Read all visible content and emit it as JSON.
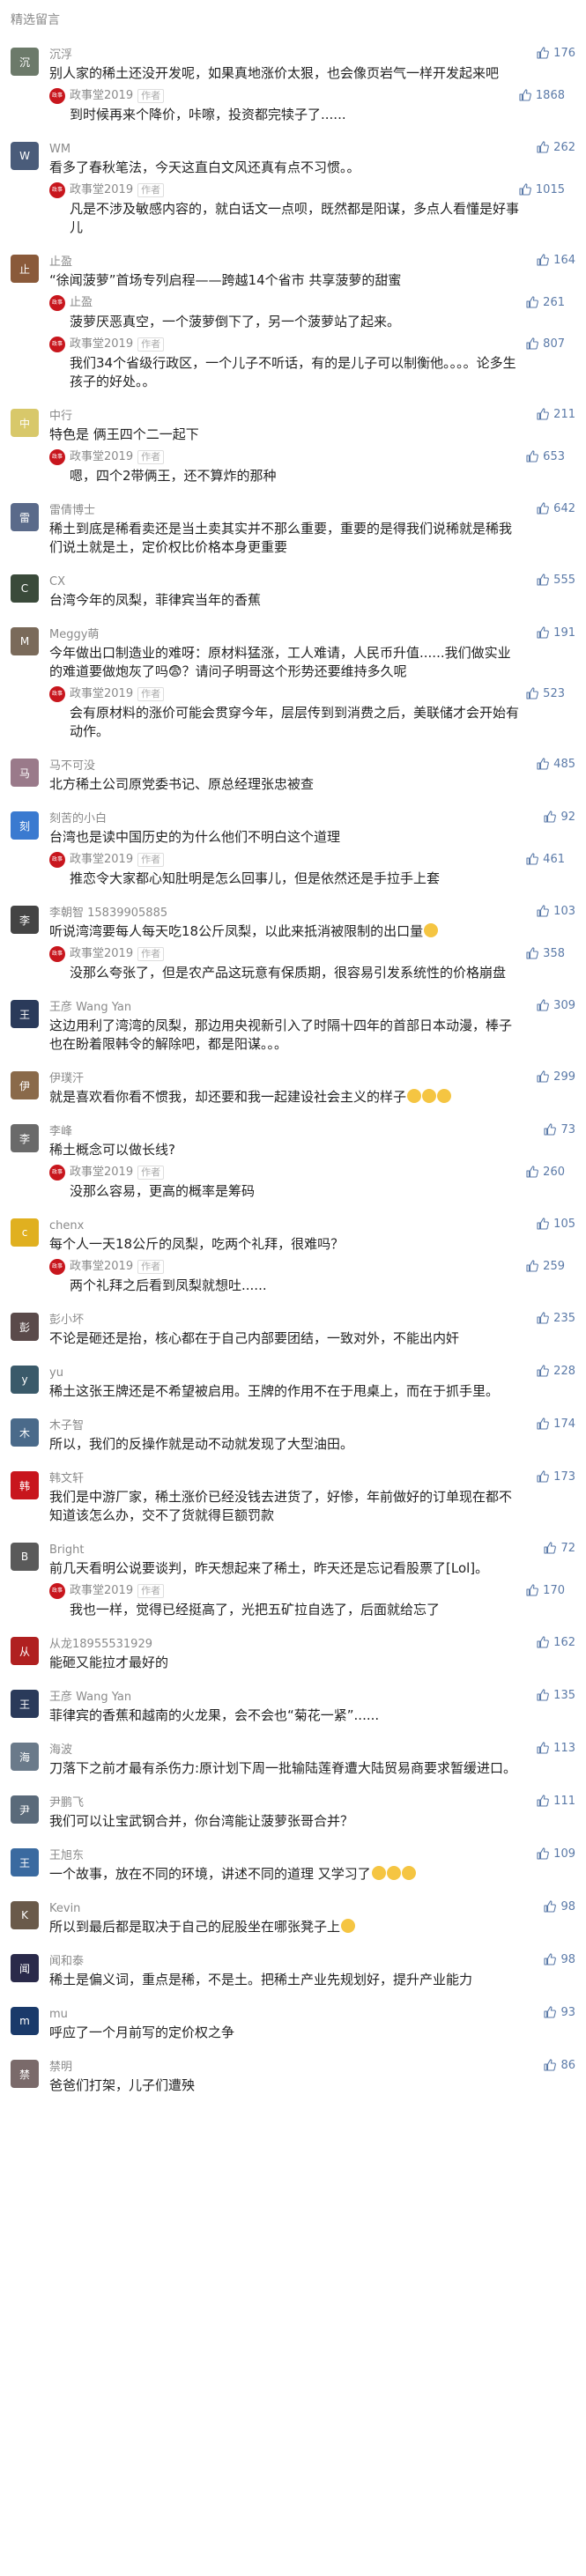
{
  "header": {
    "title": "精选留言"
  },
  "colors": {
    "like": "#5b7aa8",
    "author_avatar": "#c8161d"
  },
  "comments": [
    {
      "nick": "沉浮",
      "likes": "176",
      "text": "别人家的稀土还没开发呢，如果真地涨价太狠，也会像页岩气一样开发起来吧",
      "avatar": "#6c7a6a",
      "reply": {
        "name": "政事堂2019",
        "tag": "作者",
        "likes": "1868",
        "text": "到时候再来个降价，咔嚓，投资都完犊子了......"
      }
    },
    {
      "nick": "WM",
      "likes": "262",
      "text": "看多了春秋笔法，今天这直白文风还真有点不习惯。。",
      "avatar": "#4a5c7a",
      "reply": {
        "name": "政事堂2019",
        "tag": "作者",
        "likes": "1015",
        "text": "凡是不涉及敏感内容的，就白话文一点呗，既然都是阳谋，多点人看懂是好事儿"
      }
    },
    {
      "nick": "止盈",
      "likes": "164",
      "text": "“徐闻菠萝”首场专列启程——跨越14个省市 共享菠萝的甜蜜",
      "avatar": "#8a5a3a",
      "reply": {
        "name": "止盈",
        "tag": "",
        "likes": "261",
        "text": "菠萝厌恶真空，一个菠萝倒下了，另一个菠萝站了起来。"
      },
      "reply2": {
        "name": "政事堂2019",
        "tag": "作者",
        "likes": "807",
        "text": "我们34个省级行政区，一个儿子不听话，有的是儿子可以制衡他。。。。论多生孩子的好处。。"
      }
    },
    {
      "nick": "中行",
      "likes": "211",
      "text": "特色是 俩王四个二一起下",
      "avatar": "#d8c86a",
      "reply": {
        "name": "政事堂2019",
        "tag": "作者",
        "likes": "653",
        "text": "嗯，四个2带俩王，还不算炸的那种"
      }
    },
    {
      "nick": "雷倩博士",
      "likes": "642",
      "text": "稀土到底是稀看卖还是当土卖其实并不那么重要，重要的是得我们说稀就是稀我们说土就是土，定价权比价格本身更重要",
      "avatar": "#5a6a8a"
    },
    {
      "nick": "CX",
      "likes": "555",
      "text": "台湾今年的凤梨，菲律宾当年的香蕉",
      "avatar": "#3a4a3a"
    },
    {
      "nick": "Meggy萌",
      "likes": "191",
      "text": "今年做出口制造业的难呀：原材料猛涨，工人难请，人民币升值......我们做实业的难道要做炮灰了吗😨？请问子明哥这个形势还要维持多久呢",
      "avatar": "#7a6a5a",
      "reply": {
        "name": "政事堂2019",
        "tag": "作者",
        "likes": "523",
        "text": "会有原材料的涨价可能会贯穿今年，层层传到到消费之后，美联储才会开始有动作。"
      }
    },
    {
      "nick": "马不可没",
      "likes": "485",
      "text": "北方稀土公司原党委书记、原总经理张忠被查",
      "avatar": "#9a7a8a"
    },
    {
      "nick": "刻苦的小白",
      "likes": "92",
      "text": "台湾也是读中国历史的为什么他们不明白这个道理",
      "avatar": "#3a7ad0",
      "reply": {
        "name": "政事堂2019",
        "tag": "作者",
        "likes": "461",
        "text": "推恋令大家都心知肚明是怎么回事儿，但是依然还是手拉手上套"
      }
    },
    {
      "nick": "李朝智 15839905885",
      "likes": "103",
      "text": "听说湾湾要每人每天吃18公斤凤梨，以此来抵消被限制的出口量",
      "avatar": "#444444",
      "emoji": true,
      "reply": {
        "name": "政事堂2019",
        "tag": "作者",
        "likes": "358",
        "text": "没那么夸张了，但是农产品这玩意有保质期，很容易引发系统性的价格崩盘"
      }
    },
    {
      "nick": "王彦 Wang Yan",
      "likes": "309",
      "text": "这边用利了湾湾的凤梨，那边用央视新引入了时隔十四年的首部日本动漫，棒子也在盼着限韩令的解除吧，都是阳谋。。。",
      "avatar": "#2a3a5a"
    },
    {
      "nick": "伊璞汗",
      "likes": "299",
      "text": "就是喜欢看你看不惯我，却还要和我一起建设社会主义的样子",
      "avatar": "#8a6a4a",
      "emoji3": true
    },
    {
      "nick": "李峰",
      "likes": "73",
      "text": "稀土概念可以做长线?",
      "avatar": "#6a6a6a",
      "reply": {
        "name": "政事堂2019",
        "tag": "作者",
        "likes": "260",
        "text": "没那么容易，更高的概率是筹码"
      }
    },
    {
      "nick": "chenx",
      "likes": "105",
      "text": "每个人一天18公斤的凤梨，吃两个礼拜，很难吗？",
      "avatar": "#e0b020",
      "reply": {
        "name": "政事堂2019",
        "tag": "作者",
        "likes": "259",
        "text": "两个礼拜之后看到凤梨就想吐......"
      }
    },
    {
      "nick": "彭小坏",
      "likes": "235",
      "text": "不论是砸还是抬，核心都在于自己内部要团结，一致对外，不能出内奸",
      "avatar": "#5a4a4a"
    },
    {
      "nick": "yu",
      "likes": "228",
      "text": "稀土这张王牌还是不希望被启用。王牌的作用不在于甩桌上，而在于抓手里。",
      "avatar": "#3a5a6a"
    },
    {
      "nick": "木子智",
      "likes": "174",
      "text": "所以，我们的反操作就是动不动就发现了大型油田。",
      "avatar": "#4a6a8a"
    },
    {
      "nick": "韩文轩",
      "likes": "173",
      "text": "我们是中游厂家，稀土涨价已经没钱去进货了，好惨，年前做好的订单现在都不知道该怎么办，交不了货就得巨额罚款",
      "avatar": "#c8161d"
    },
    {
      "nick": "Bright",
      "likes": "72",
      "text": "前几天看明公说要谈判，昨天想起来了稀土，昨天还是忘记看股票了[Lol]。",
      "avatar": "#5a5a5a",
      "reply": {
        "name": "政事堂2019",
        "tag": "作者",
        "likes": "170",
        "text": "我也一样，觉得已经挺高了，光把五矿拉自选了，后面就给忘了"
      }
    },
    {
      "nick": "从龙18955531929",
      "likes": "162",
      "text": "能砸又能拉才最好的",
      "avatar": "#b02020"
    },
    {
      "nick": "王彦 Wang Yan",
      "likes": "135",
      "text": "菲律宾的香蕉和越南的火龙果，会不会也“菊花一紧”......",
      "avatar": "#2a3a5a"
    },
    {
      "nick": "海波",
      "likes": "113",
      "text": "刀落下之前才最有杀伤力:原计划下周一批输陆莲脊遭大陆贸易商要求暂缓进口。",
      "avatar": "#6a7a8a"
    },
    {
      "nick": "尹鹏飞",
      "likes": "111",
      "text": "我们可以让宝武钢合并，你台湾能让菠萝张哥合并？",
      "avatar": "#5a6a7a"
    },
    {
      "nick": "王旭东",
      "likes": "109",
      "text": "一个故事，放在不同的环境，讲述不同的道理 又学习了",
      "avatar": "#3a6aa0",
      "emoji3b": true
    },
    {
      "nick": "Kevin",
      "likes": "98",
      "text": "所以到最后都是取决于自己的屁股坐在哪张凳子上",
      "avatar": "#6a5a4a",
      "emoji": true
    },
    {
      "nick": "闻和泰",
      "likes": "98",
      "text": "稀土是偏义词，重点是稀，不是土。把稀土产业先规划好，提升产业能力",
      "avatar": "#2a2a4a"
    },
    {
      "nick": "mu",
      "likes": "93",
      "text": "呼应了一个月前写的定价权之争",
      "avatar": "#1a3a6a"
    },
    {
      "nick": "禁明",
      "likes": "86",
      "text": "爸爸们打架，儿子们遭殃",
      "avatar": "#7a6a6a"
    }
  ]
}
